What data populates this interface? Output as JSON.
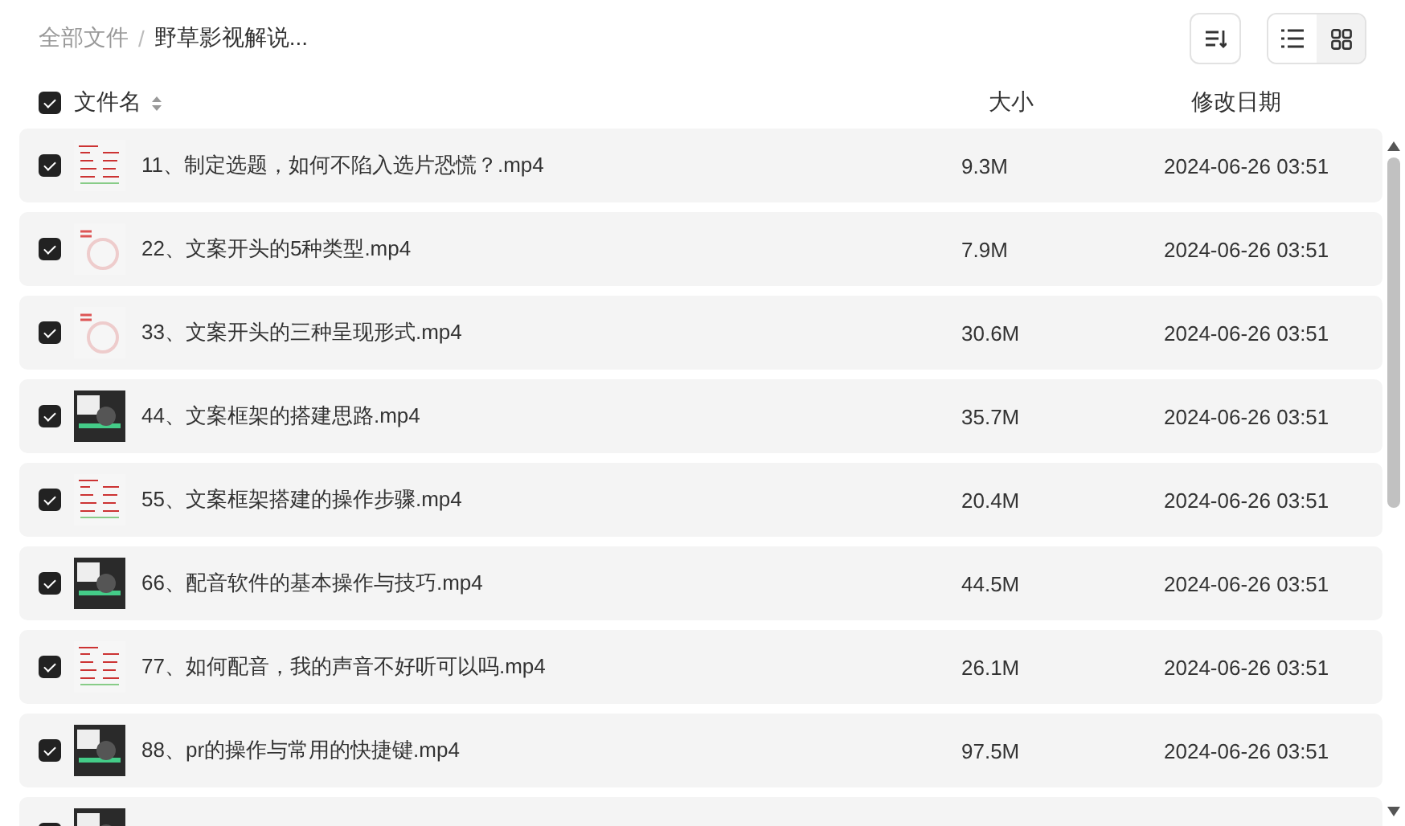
{
  "breadcrumb_separator": "/",
  "breadcrumb": [
    {
      "label": "全部文件",
      "current": false
    },
    {
      "label": "野草影视解说...",
      "current": true
    }
  ],
  "toolbar": {
    "view_modes": [
      {
        "kind": "list",
        "selected": true
      },
      {
        "kind": "grid",
        "selected": false
      }
    ]
  },
  "header": {
    "checked": true,
    "columns": [
      "文件名",
      "大小",
      "修改日期"
    ]
  },
  "files": [
    {
      "checked": true,
      "kind": "slide",
      "name": "11、制定选题，如何不陷入选片恐慌？.mp4",
      "size": "9.3M",
      "modified": "2024-06-26 03:51"
    },
    {
      "checked": true,
      "kind": "logo",
      "name": "22、文案开头的5种类型.mp4",
      "size": "7.9M",
      "modified": "2024-06-26 03:51"
    },
    {
      "checked": true,
      "kind": "logo",
      "name": "33、文案开头的三种呈现形式.mp4",
      "size": "30.6M",
      "modified": "2024-06-26 03:51"
    },
    {
      "checked": true,
      "kind": "dark",
      "name": "44、文案框架的搭建思路.mp4",
      "size": "35.7M",
      "modified": "2024-06-26 03:51"
    },
    {
      "checked": true,
      "kind": "slide",
      "name": "55、文案框架搭建的操作步骤.mp4",
      "size": "20.4M",
      "modified": "2024-06-26 03:51"
    },
    {
      "checked": true,
      "kind": "dark",
      "name": "66、配音软件的基本操作与技巧.mp4",
      "size": "44.5M",
      "modified": "2024-06-26 03:51"
    },
    {
      "checked": true,
      "kind": "slide",
      "name": "77、如何配音，我的声音不好听可以吗.mp4",
      "size": "26.1M",
      "modified": "2024-06-26 03:51"
    },
    {
      "checked": true,
      "kind": "dark",
      "name": "88、pr的操作与常用的快捷键.mp4",
      "size": "97.5M",
      "modified": "2024-06-26 03:51"
    },
    {
      "checked": true,
      "kind": "dark"
    }
  ]
}
